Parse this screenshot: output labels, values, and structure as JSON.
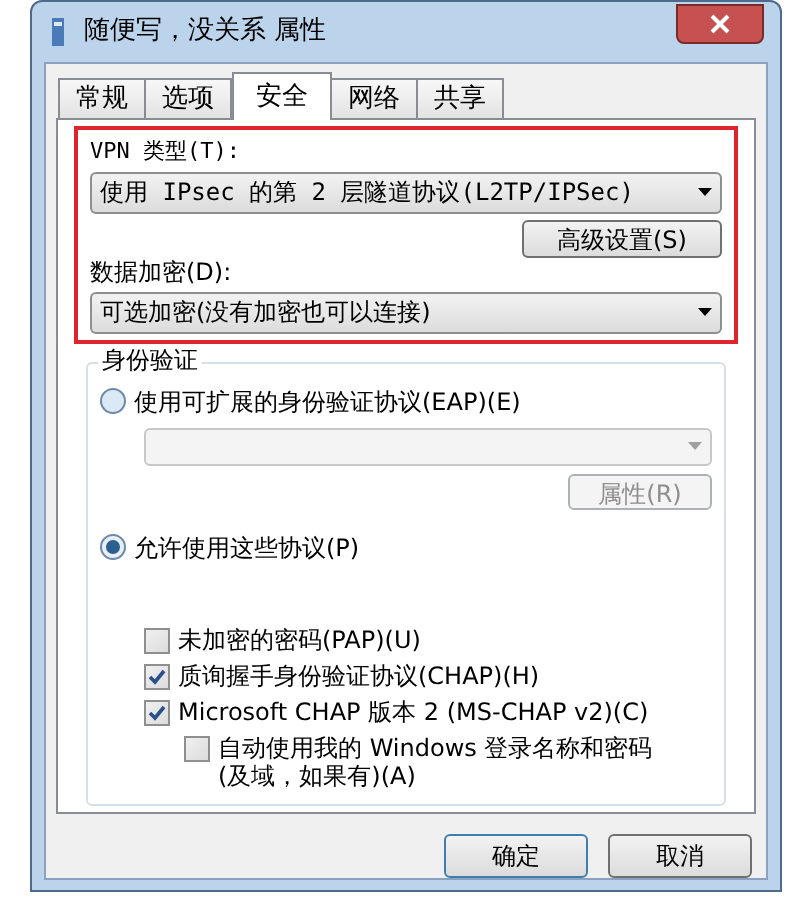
{
  "window": {
    "title": "随便写，没关系 属性"
  },
  "tabs": [
    {
      "label": "常规",
      "selected": false
    },
    {
      "label": "选项",
      "selected": false
    },
    {
      "label": "安全",
      "selected": true
    },
    {
      "label": "网络",
      "selected": false
    },
    {
      "label": "共享",
      "selected": false
    }
  ],
  "vpn_type": {
    "label": "VPN 类型(T):",
    "value": "使用 IPsec 的第 2 层隧道协议(L2TP/IPSec)"
  },
  "advanced_button": {
    "label": "高级设置(S)"
  },
  "data_encryption": {
    "label": "数据加密(D):",
    "value": "可选加密(没有加密也可以连接)"
  },
  "authentication": {
    "title": "身份验证",
    "options": [
      {
        "label": "使用可扩展的身份验证协议(EAP)(E)",
        "selected": false
      },
      {
        "label": "允许使用这些协议(P)",
        "selected": true
      }
    ],
    "properties_button": {
      "label": "属性(R)",
      "disabled": true
    },
    "protocols": [
      {
        "kind": "protocol",
        "label": "未加密的密码(PAP)(U)",
        "checked": false
      },
      {
        "kind": "protocol",
        "label": "质询握手身份验证协议(CHAP)(H)",
        "checked": true
      },
      {
        "kind": "protocol",
        "label": "Microsoft CHAP 版本 2 (MS-CHAP v2)(C)",
        "checked": true
      },
      {
        "kind": "sub",
        "label": "自动使用我的 Windows 登录名称和密码(及域，如果有)(A)",
        "checked": false
      }
    ]
  },
  "buttons": [
    {
      "label": "确定"
    },
    {
      "label": "取消"
    }
  ]
}
